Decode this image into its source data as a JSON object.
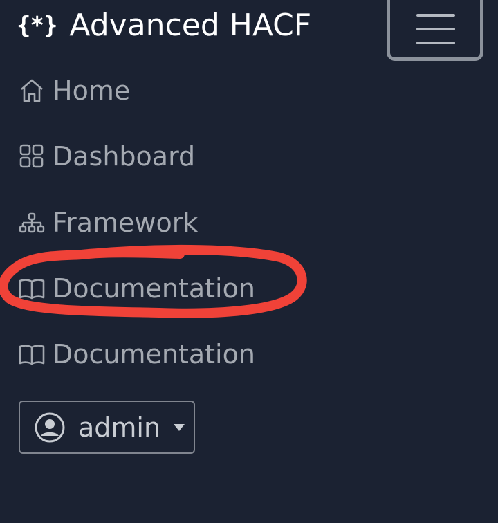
{
  "brand": {
    "icon_text": "{*}",
    "title": "Advanced HACF"
  },
  "nav": {
    "items": [
      {
        "label": "Home",
        "icon": "house-icon"
      },
      {
        "label": "Dashboard",
        "icon": "grid-icon"
      },
      {
        "label": "Framework",
        "icon": "sitemap-icon"
      },
      {
        "label": "Documentation",
        "icon": "book-icon"
      },
      {
        "label": "Documentation",
        "icon": "book-icon"
      }
    ]
  },
  "user_menu": {
    "username": "admin",
    "icon": "person-circle-icon",
    "caret_icon": "caret-down-icon"
  },
  "colors": {
    "background": "#1b2232",
    "nav_text": "#a4a9b1",
    "annotation_stroke": "#f04238"
  },
  "annotation": {
    "type": "hand-drawn-ellipse",
    "target": "Documentation"
  }
}
